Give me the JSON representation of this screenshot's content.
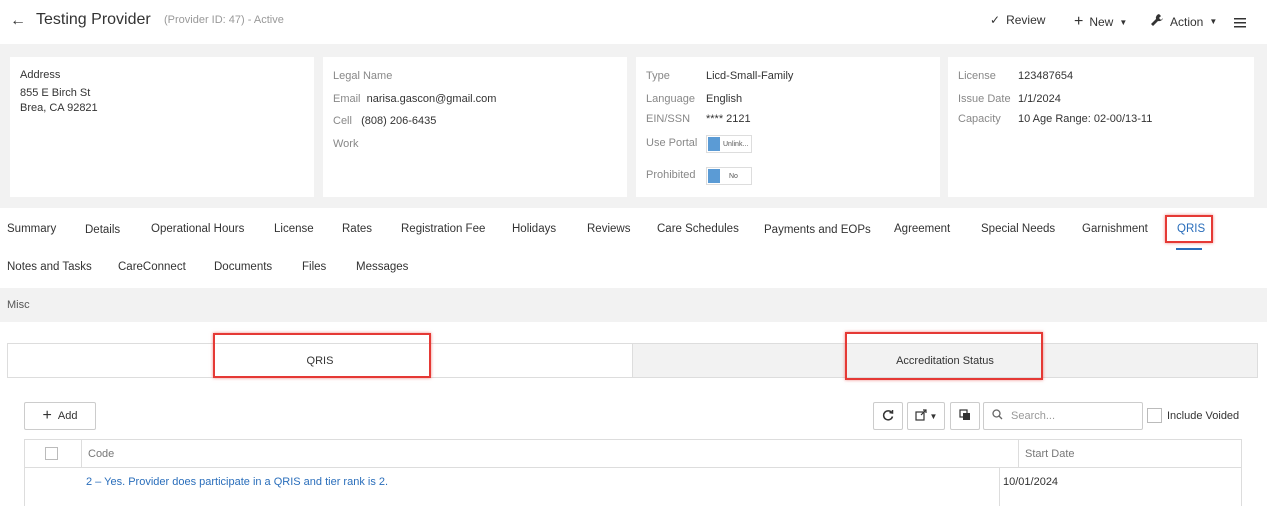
{
  "header": {
    "title": "Testing Provider",
    "subtitle": "(Provider ID: 47) - Active",
    "review_label": "Review",
    "new_label": "New",
    "action_label": "Action"
  },
  "address_card": {
    "label": "Address",
    "line1": "855 E Birch St",
    "line2": "Brea, CA 92821"
  },
  "contact_card": {
    "legal_name_label": "Legal Name",
    "email_label": "Email",
    "email_value": "narisa.gascon@gmail.com",
    "cell_label": "Cell",
    "cell_value": "(808) 206-6435",
    "work_label": "Work"
  },
  "type_card": {
    "type_label": "Type",
    "type_value": "Licd-Small-Family",
    "language_label": "Language",
    "language_value": "English",
    "ein_label": "EIN/SSN",
    "ein_value": "**** 2121",
    "use_portal_label": "Use Portal",
    "use_portal_value": "Unlink...",
    "prohibited_label": "Prohibited",
    "prohibited_value": "No"
  },
  "license_card": {
    "license_label": "License",
    "license_value": "123487654",
    "issue_date_label": "Issue Date",
    "issue_date_value": "1/1/2024",
    "capacity_label": "Capacity",
    "capacity_value": "10 Age Range: 02-00/13-11"
  },
  "tabs_row1": [
    "Summary",
    "Details",
    "Operational Hours",
    "License",
    "Rates",
    "Registration Fee",
    "Holidays",
    "Reviews",
    "Care Schedules",
    "Payments and EOPs",
    "Agreement",
    "Special Needs",
    "Garnishment",
    "QRIS"
  ],
  "tabs_row2": [
    "Notes and Tasks",
    "CareConnect",
    "Documents",
    "Files",
    "Messages"
  ],
  "active_tab": "QRIS",
  "misc_label": "Misc",
  "subtabs": [
    "QRIS",
    "Accreditation Status"
  ],
  "toolbar": {
    "add_label": "Add",
    "search_placeholder": "Search...",
    "include_voided_label": "Include Voided"
  },
  "grid": {
    "columns": [
      "Code",
      "Start Date"
    ],
    "rows": [
      {
        "code": "2 – Yes. Provider does participate in a QRIS and tier rank is 2.",
        "start_date": "10/01/2024"
      }
    ]
  },
  "colors": {
    "accent": "#2a6ebb",
    "highlight": "#e53935",
    "toggle": "#5b9bd5"
  }
}
